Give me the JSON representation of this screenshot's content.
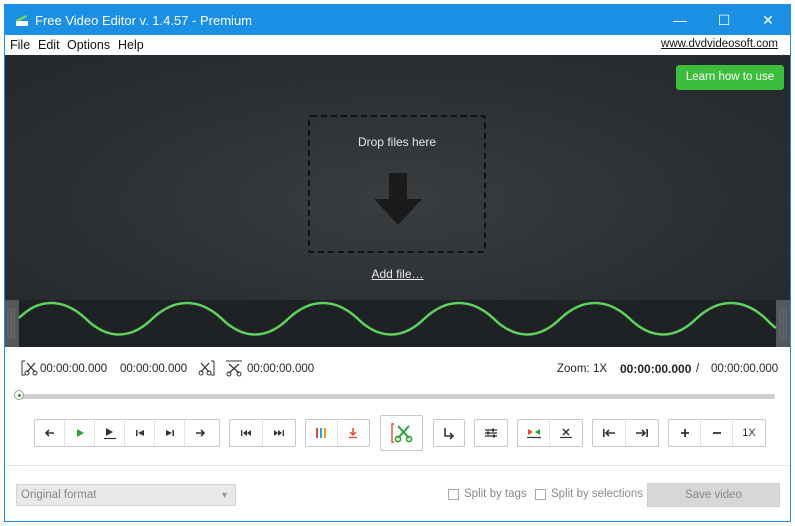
{
  "window": {
    "title": "Free Video Editor v. 1.4.57 - Premium",
    "minimize": "—",
    "maximize": "☐",
    "close": "✕"
  },
  "menu": {
    "items": [
      "File",
      "Edit",
      "Options",
      "Help"
    ],
    "site_link": "www.dvdvideosoft.com"
  },
  "preview": {
    "learn_button": "Learn how to use",
    "drop_text": "Drop files here",
    "add_file": "Add file…"
  },
  "timecodes": {
    "selection_start": "00:00:00.000",
    "selection_end": "00:00:00.000",
    "selection_length": "00:00:00.000",
    "zoom_label": "Zoom:",
    "zoom_value": "1X",
    "current_time": "00:00:00.000",
    "separator": "/",
    "total_time": "00:00:00.000"
  },
  "toolbar": {
    "zoom_reset": "1X"
  },
  "bottom": {
    "format_value": "Original format",
    "split_by_tags": "Split by tags",
    "split_by_selections": "Split by selections",
    "save_button": "Save video"
  },
  "colors": {
    "accent": "#1a8fe3",
    "green": "#3cbd3c",
    "wave": "#5fd15f",
    "red": "#e04a3a"
  }
}
